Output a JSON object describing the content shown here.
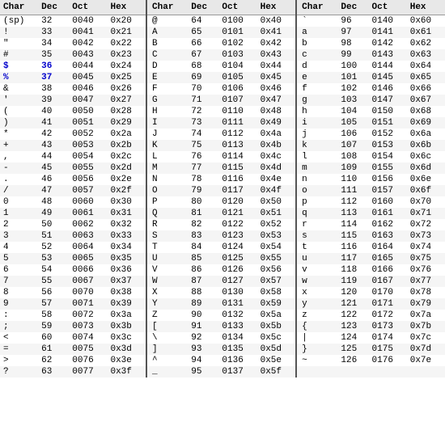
{
  "columns": [
    "Char",
    "Dec",
    "Oct",
    "Hex"
  ],
  "rows": [
    [
      "(sp)",
      "32",
      "0040",
      "0x20",
      "@",
      "64",
      "0100",
      "0x40",
      "`",
      "96",
      "0140",
      "0x60"
    ],
    [
      "!",
      "33",
      "0041",
      "0x21",
      "A",
      "65",
      "0101",
      "0x41",
      "a",
      "97",
      "0141",
      "0x61"
    ],
    [
      "\"",
      "34",
      "0042",
      "0x22",
      "B",
      "66",
      "0102",
      "0x42",
      "b",
      "98",
      "0142",
      "0x62"
    ],
    [
      "#",
      "35",
      "0043",
      "0x23",
      "C",
      "67",
      "0103",
      "0x43",
      "c",
      "99",
      "0143",
      "0x63"
    ],
    [
      "$",
      "36",
      "0044",
      "0x24",
      "D",
      "68",
      "0104",
      "0x44",
      "d",
      "100",
      "0144",
      "0x64"
    ],
    [
      "%",
      "37",
      "0045",
      "0x25",
      "E",
      "69",
      "0105",
      "0x45",
      "e",
      "101",
      "0145",
      "0x65"
    ],
    [
      "&",
      "38",
      "0046",
      "0x26",
      "F",
      "70",
      "0106",
      "0x46",
      "f",
      "102",
      "0146",
      "0x66"
    ],
    [
      "'",
      "39",
      "0047",
      "0x27",
      "G",
      "71",
      "0107",
      "0x47",
      "g",
      "103",
      "0147",
      "0x67"
    ],
    [
      "(",
      "40",
      "0050",
      "0x28",
      "H",
      "72",
      "0110",
      "0x48",
      "h",
      "104",
      "0150",
      "0x68"
    ],
    [
      ")",
      "41",
      "0051",
      "0x29",
      "I",
      "73",
      "0111",
      "0x49",
      "i",
      "105",
      "0151",
      "0x69"
    ],
    [
      "*",
      "42",
      "0052",
      "0x2a",
      "J",
      "74",
      "0112",
      "0x4a",
      "j",
      "106",
      "0152",
      "0x6a"
    ],
    [
      "+",
      "43",
      "0053",
      "0x2b",
      "K",
      "75",
      "0113",
      "0x4b",
      "k",
      "107",
      "0153",
      "0x6b"
    ],
    [
      ",",
      "44",
      "0054",
      "0x2c",
      "L",
      "76",
      "0114",
      "0x4c",
      "l",
      "108",
      "0154",
      "0x6c"
    ],
    [
      "-",
      "45",
      "0055",
      "0x2d",
      "M",
      "77",
      "0115",
      "0x4d",
      "m",
      "109",
      "0155",
      "0x6d"
    ],
    [
      ".",
      "46",
      "0056",
      "0x2e",
      "N",
      "78",
      "0116",
      "0x4e",
      "n",
      "110",
      "0156",
      "0x6e"
    ],
    [
      "/",
      "47",
      "0057",
      "0x2f",
      "O",
      "79",
      "0117",
      "0x4f",
      "o",
      "111",
      "0157",
      "0x6f"
    ],
    [
      "0",
      "48",
      "0060",
      "0x30",
      "P",
      "80",
      "0120",
      "0x50",
      "p",
      "112",
      "0160",
      "0x70"
    ],
    [
      "1",
      "49",
      "0061",
      "0x31",
      "Q",
      "81",
      "0121",
      "0x51",
      "q",
      "113",
      "0161",
      "0x71"
    ],
    [
      "2",
      "50",
      "0062",
      "0x32",
      "R",
      "82",
      "0122",
      "0x52",
      "r",
      "114",
      "0162",
      "0x72"
    ],
    [
      "3",
      "51",
      "0063",
      "0x33",
      "S",
      "83",
      "0123",
      "0x53",
      "s",
      "115",
      "0163",
      "0x73"
    ],
    [
      "4",
      "52",
      "0064",
      "0x34",
      "T",
      "84",
      "0124",
      "0x54",
      "t",
      "116",
      "0164",
      "0x74"
    ],
    [
      "5",
      "53",
      "0065",
      "0x35",
      "U",
      "85",
      "0125",
      "0x55",
      "u",
      "117",
      "0165",
      "0x75"
    ],
    [
      "6",
      "54",
      "0066",
      "0x36",
      "V",
      "86",
      "0126",
      "0x56",
      "v",
      "118",
      "0166",
      "0x76"
    ],
    [
      "7",
      "55",
      "0067",
      "0x37",
      "W",
      "87",
      "0127",
      "0x57",
      "w",
      "119",
      "0167",
      "0x77"
    ],
    [
      "8",
      "56",
      "0070",
      "0x38",
      "X",
      "88",
      "0130",
      "0x58",
      "x",
      "120",
      "0170",
      "0x78"
    ],
    [
      "9",
      "57",
      "0071",
      "0x39",
      "Y",
      "89",
      "0131",
      "0x59",
      "y",
      "121",
      "0171",
      "0x79"
    ],
    [
      ":",
      "58",
      "0072",
      "0x3a",
      "Z",
      "90",
      "0132",
      "0x5a",
      "z",
      "122",
      "0172",
      "0x7a"
    ],
    [
      ";",
      "59",
      "0073",
      "0x3b",
      "[",
      "91",
      "0133",
      "0x5b",
      "{",
      "123",
      "0173",
      "0x7b"
    ],
    [
      "<",
      "60",
      "0074",
      "0x3c",
      "\\",
      "92",
      "0134",
      "0x5c",
      "|",
      "124",
      "0174",
      "0x7c"
    ],
    [
      "=",
      "61",
      "0075",
      "0x3d",
      "]",
      "93",
      "0135",
      "0x5d",
      "}",
      "125",
      "0175",
      "0x7d"
    ],
    [
      ">",
      "62",
      "0076",
      "0x3e",
      "^",
      "94",
      "0136",
      "0x5e",
      "~",
      "126",
      "0176",
      "0x7e"
    ],
    [
      "?",
      "63",
      "0077",
      "0x3f",
      "_",
      "95",
      "0137",
      "0x5f",
      "",
      "",
      "",
      ""
    ]
  ]
}
